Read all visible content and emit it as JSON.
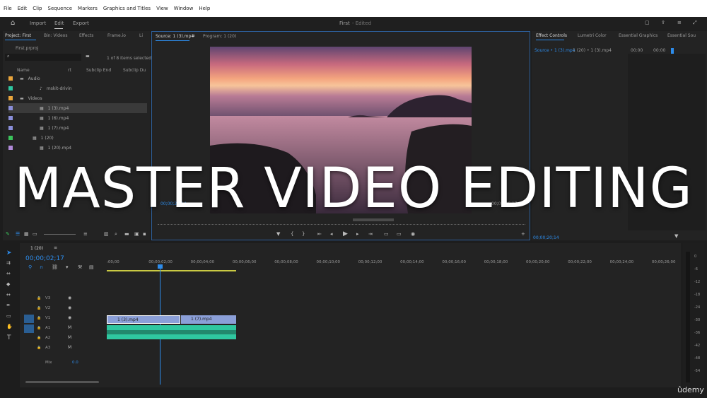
{
  "menu": [
    "File",
    "Edit",
    "Clip",
    "Sequence",
    "Markers",
    "Graphics and Titles",
    "View",
    "Window",
    "Help"
  ],
  "header": {
    "import": "Import",
    "edit": "Edit",
    "export": "Export",
    "doc_title": "First",
    "doc_status": "- Edited"
  },
  "project": {
    "tabs": [
      "Project: First",
      "Bin: Videos",
      "Effects",
      "Frame.io",
      "Li"
    ],
    "file": "First.prproj",
    "count": "1 of 8 items selected",
    "cols": [
      "Name",
      "rt",
      "Subclip End",
      "Subclip Du"
    ],
    "items": [
      {
        "label": "Audio",
        "color": "#e9a53c",
        "kind": "folder"
      },
      {
        "label": "mskit-drivin",
        "color": "#2fc7a0",
        "kind": "audio"
      },
      {
        "label": "Videos",
        "color": "#e9a53c",
        "kind": "folder"
      },
      {
        "label": "1 (3).mp4",
        "color": "#8a8ed9",
        "kind": "video"
      },
      {
        "label": "1 (6).mp4",
        "color": "#8a8ed9",
        "kind": "video"
      },
      {
        "label": "1 (7).mp4",
        "color": "#8a8ed9",
        "kind": "video"
      },
      {
        "label": "1 (20)",
        "color": "#3bc45c",
        "kind": "seq"
      },
      {
        "label": "1 (20).mp4",
        "color": "#b08ad9",
        "kind": "video"
      }
    ]
  },
  "source": {
    "tab": "Source: 1 (3).mp4",
    "program": "Program: 1 (20)",
    "timecode": "00;00;20;14",
    "duration": "00;00;06;17"
  },
  "effects": {
    "tabs": [
      "Effect Controls",
      "Lumetri Color",
      "Essential Graphics",
      "Essential Sou"
    ],
    "source": "Source • 1 (3).mp4",
    "seq": "1 (20) • 1 (3).mp4",
    "t1": "00:00",
    "t2": "00:00",
    "timecode": "00;00;20;14"
  },
  "timeline": {
    "tab": "1 (20)",
    "timecode": "00;00;02;17",
    "ruler": [
      ":00;00",
      "00;00;02;00",
      "00;00;04;00",
      "00;00;06;00",
      "00;00;08;00",
      "00;00;10;00",
      "00;00;12;00",
      "00;00;14;00",
      "00;00;16;00",
      "00;00;18;00",
      "00;00;20;00",
      "00;00;22;00",
      "00;00;24;00",
      "00;00;26;00"
    ],
    "tracks": [
      "V3",
      "V2",
      "V1",
      "A1",
      "A2",
      "A3"
    ],
    "mix": "Mix",
    "mix_val": "0.0",
    "clip1": "1 (3).mp4",
    "clip2": "1 (7).mp4"
  },
  "meter": [
    "0",
    "-6",
    "-12",
    "-18",
    "-24",
    "-30",
    "-36",
    "-42",
    "-48",
    "-54"
  ],
  "overlay": {
    "title": "MASTER VIDEO EDITING",
    "brand": "ûdemy"
  },
  "colors": {
    "accent": "#2d8ceb",
    "video_clip": "#8b9fd8",
    "audio_clip": "#2fc7a0"
  }
}
